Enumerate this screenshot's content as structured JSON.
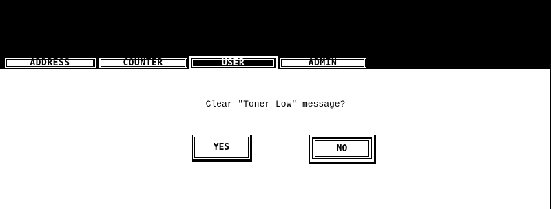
{
  "tabs": [
    {
      "label": "ADDRESS",
      "active": false
    },
    {
      "label": "COUNTER",
      "active": false
    },
    {
      "label": "USER",
      "active": true
    },
    {
      "label": "ADMIN",
      "active": false
    }
  ],
  "dialog": {
    "message": "Clear \"Toner Low\" message?",
    "yes_label": "YES",
    "no_label": "NO"
  },
  "colors": {
    "background": "#ffffff",
    "header": "#000000",
    "text": "#000000"
  }
}
